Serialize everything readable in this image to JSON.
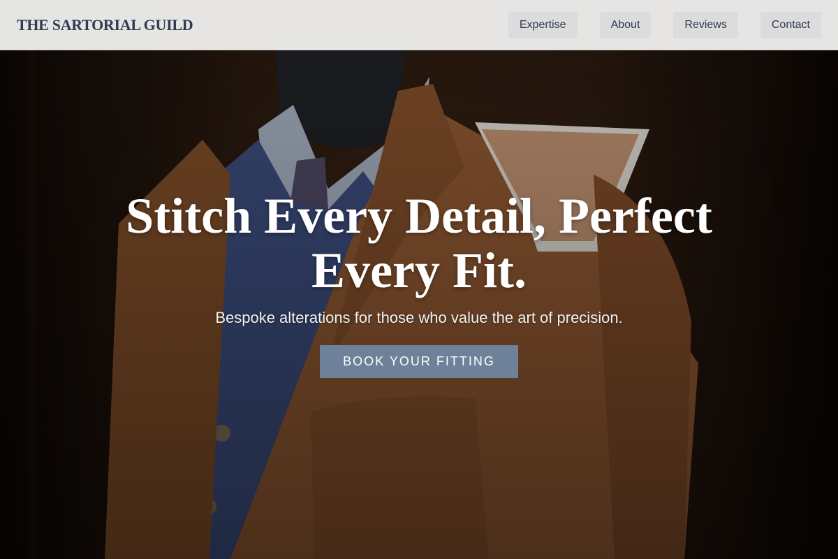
{
  "brand": {
    "name": "THE SARTORIAL GUILD"
  },
  "nav": {
    "items": [
      {
        "label": "Expertise"
      },
      {
        "label": "About"
      },
      {
        "label": "Reviews"
      },
      {
        "label": "Contact"
      }
    ]
  },
  "hero": {
    "title": "Stitch Every Detail, Perfect Every Fit.",
    "subtitle": "Bespoke alterations for those who value the art of precision.",
    "cta_label": "BOOK YOUR FITTING",
    "image": "mannequin-with-tailored-jacket"
  },
  "colors": {
    "brand_text": "#2f3b4f",
    "nav_bg": "#eeeeec",
    "nav_button_bg": "#dcdcdc",
    "cta_bg": "#6f8199"
  }
}
